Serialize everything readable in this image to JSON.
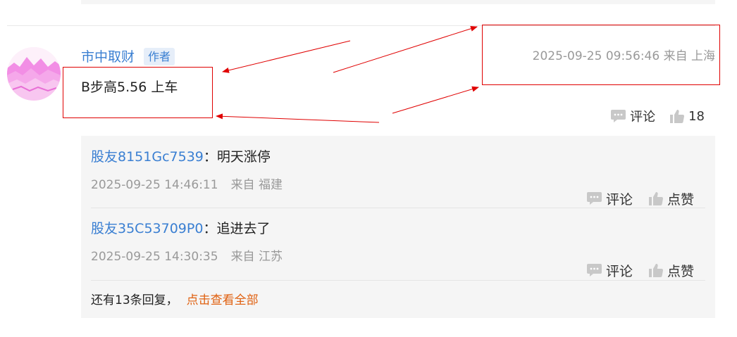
{
  "post": {
    "username": "市中取财",
    "badge": "作者",
    "text": "B步高5.56 上车",
    "timestamp": "2025-09-25 09:56:46",
    "location": "来自 上海",
    "comment_label": "评论",
    "like_count": "18"
  },
  "replies": [
    {
      "user": "股友8151Gc7539",
      "separator": "：",
      "text": "明天涨停",
      "time": "2025-09-25 14:46:11",
      "location": "来自 福建",
      "comment_label": "评论",
      "like_label": "点赞"
    },
    {
      "user": "股友35C53709P0",
      "separator": "：",
      "text": "追进去了",
      "time": "2025-09-25 14:30:35",
      "location": "来自 江苏",
      "comment_label": "评论",
      "like_label": "点赞"
    }
  ],
  "more_replies": {
    "text": "还有13条回复，",
    "link": "点击查看全部"
  },
  "colors": {
    "link_blue": "#3a7fd2",
    "annotation_red": "#e00000",
    "more_link_orange": "#e0600f",
    "icon_gray": "#c8c8c8"
  }
}
